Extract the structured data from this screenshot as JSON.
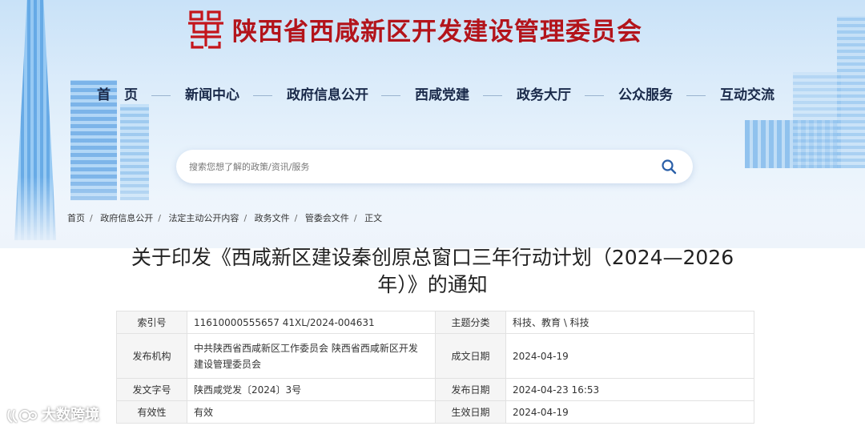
{
  "site": {
    "title": "陕西省西咸新区开发建设管理委员会",
    "brand_color": "#b3141b"
  },
  "nav": {
    "items": [
      "首　页",
      "新闻中心",
      "政府信息公开",
      "西咸党建",
      "政务大厅",
      "公众服务",
      "互动交流"
    ]
  },
  "search": {
    "placeholder": "搜索您想了解的政策/资讯/服务",
    "icon": "search-icon"
  },
  "breadcrumb": {
    "items": [
      "首页",
      "政府信息公开",
      "法定主动公开内容",
      "政务文件",
      "管委会文件",
      "正文"
    ],
    "separator": "/"
  },
  "article": {
    "title_line1": "关于印发《西咸新区建设秦创原总窗口三年行动计划（2024—2026",
    "title_line2": "年）》的通知"
  },
  "meta": {
    "index_label": "索引号",
    "index_value": "11610000555657 41XL/2024-004631",
    "topic_label": "主题分类",
    "topic_value": "科技、教育 \\ 科技",
    "issuer_label": "发布机构",
    "issuer_value_1": "中共陕西省西咸新区工作委员会 陕西省西咸新区开发",
    "issuer_value_2": "建设管理委员会",
    "written_label": "成文日期",
    "written_value": "2024-04-19",
    "docno_label": "发文字号",
    "docno_value": "陕西咸党发〔2024〕3号",
    "published_label": "发布日期",
    "published_value": "2024-04-23 16:53",
    "validity_label": "有效性",
    "validity_value": "有效",
    "effective_label": "生效日期",
    "effective_value": "2024-04-19"
  },
  "watermark": {
    "text": "大数跨境"
  }
}
